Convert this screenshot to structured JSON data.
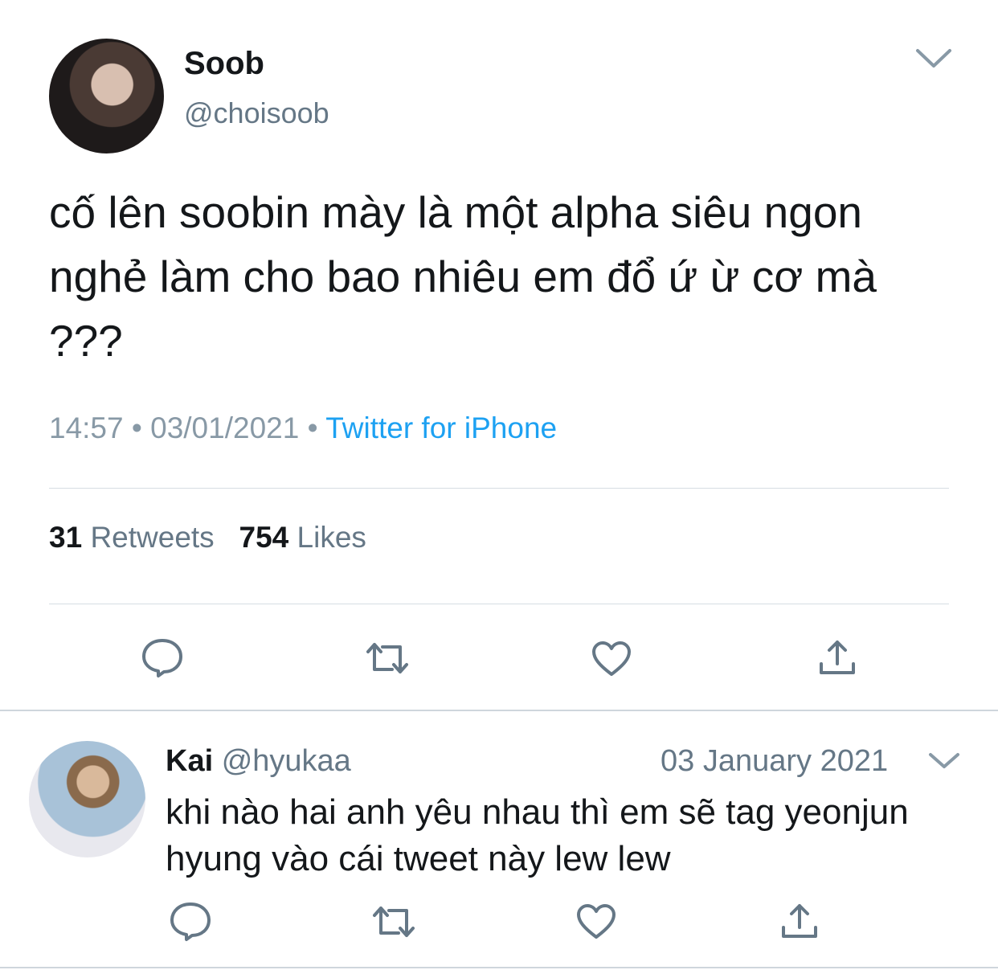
{
  "tweet": {
    "author_name": "Soob",
    "author_handle": "@choisoob",
    "text": "cố lên soobin mày là một alpha siêu ngon nghẻ làm cho bao nhiêu em đổ ứ ừ cơ mà ???",
    "time": "14:57",
    "date": "03/01/2021",
    "separator": "•",
    "source": "Twitter for iPhone",
    "retweets_count": "31",
    "retweets_label": "Retweets",
    "likes_count": "754",
    "likes_label": "Likes",
    "avatar_icon": "avatar-photo",
    "options_icon": "chevron-down-icon",
    "actions": [
      "reply-icon",
      "retweet-icon",
      "like-icon",
      "share-icon"
    ]
  },
  "reply": {
    "author_name": "Kai",
    "author_handle": "@hyukaa",
    "date": "03 January 2021",
    "text": "khi nào hai anh yêu nhau thì em sẽ tag yeonjun hyung vào cái tweet này lew lew",
    "avatar_icon": "avatar-photo",
    "options_icon": "chevron-down-icon",
    "actions": [
      "reply-icon",
      "retweet-icon",
      "like-icon",
      "share-icon"
    ]
  },
  "colors": {
    "text": "#14171a",
    "secondary": "#657786",
    "link": "#1da1f2",
    "divider": "#d6dde3"
  }
}
